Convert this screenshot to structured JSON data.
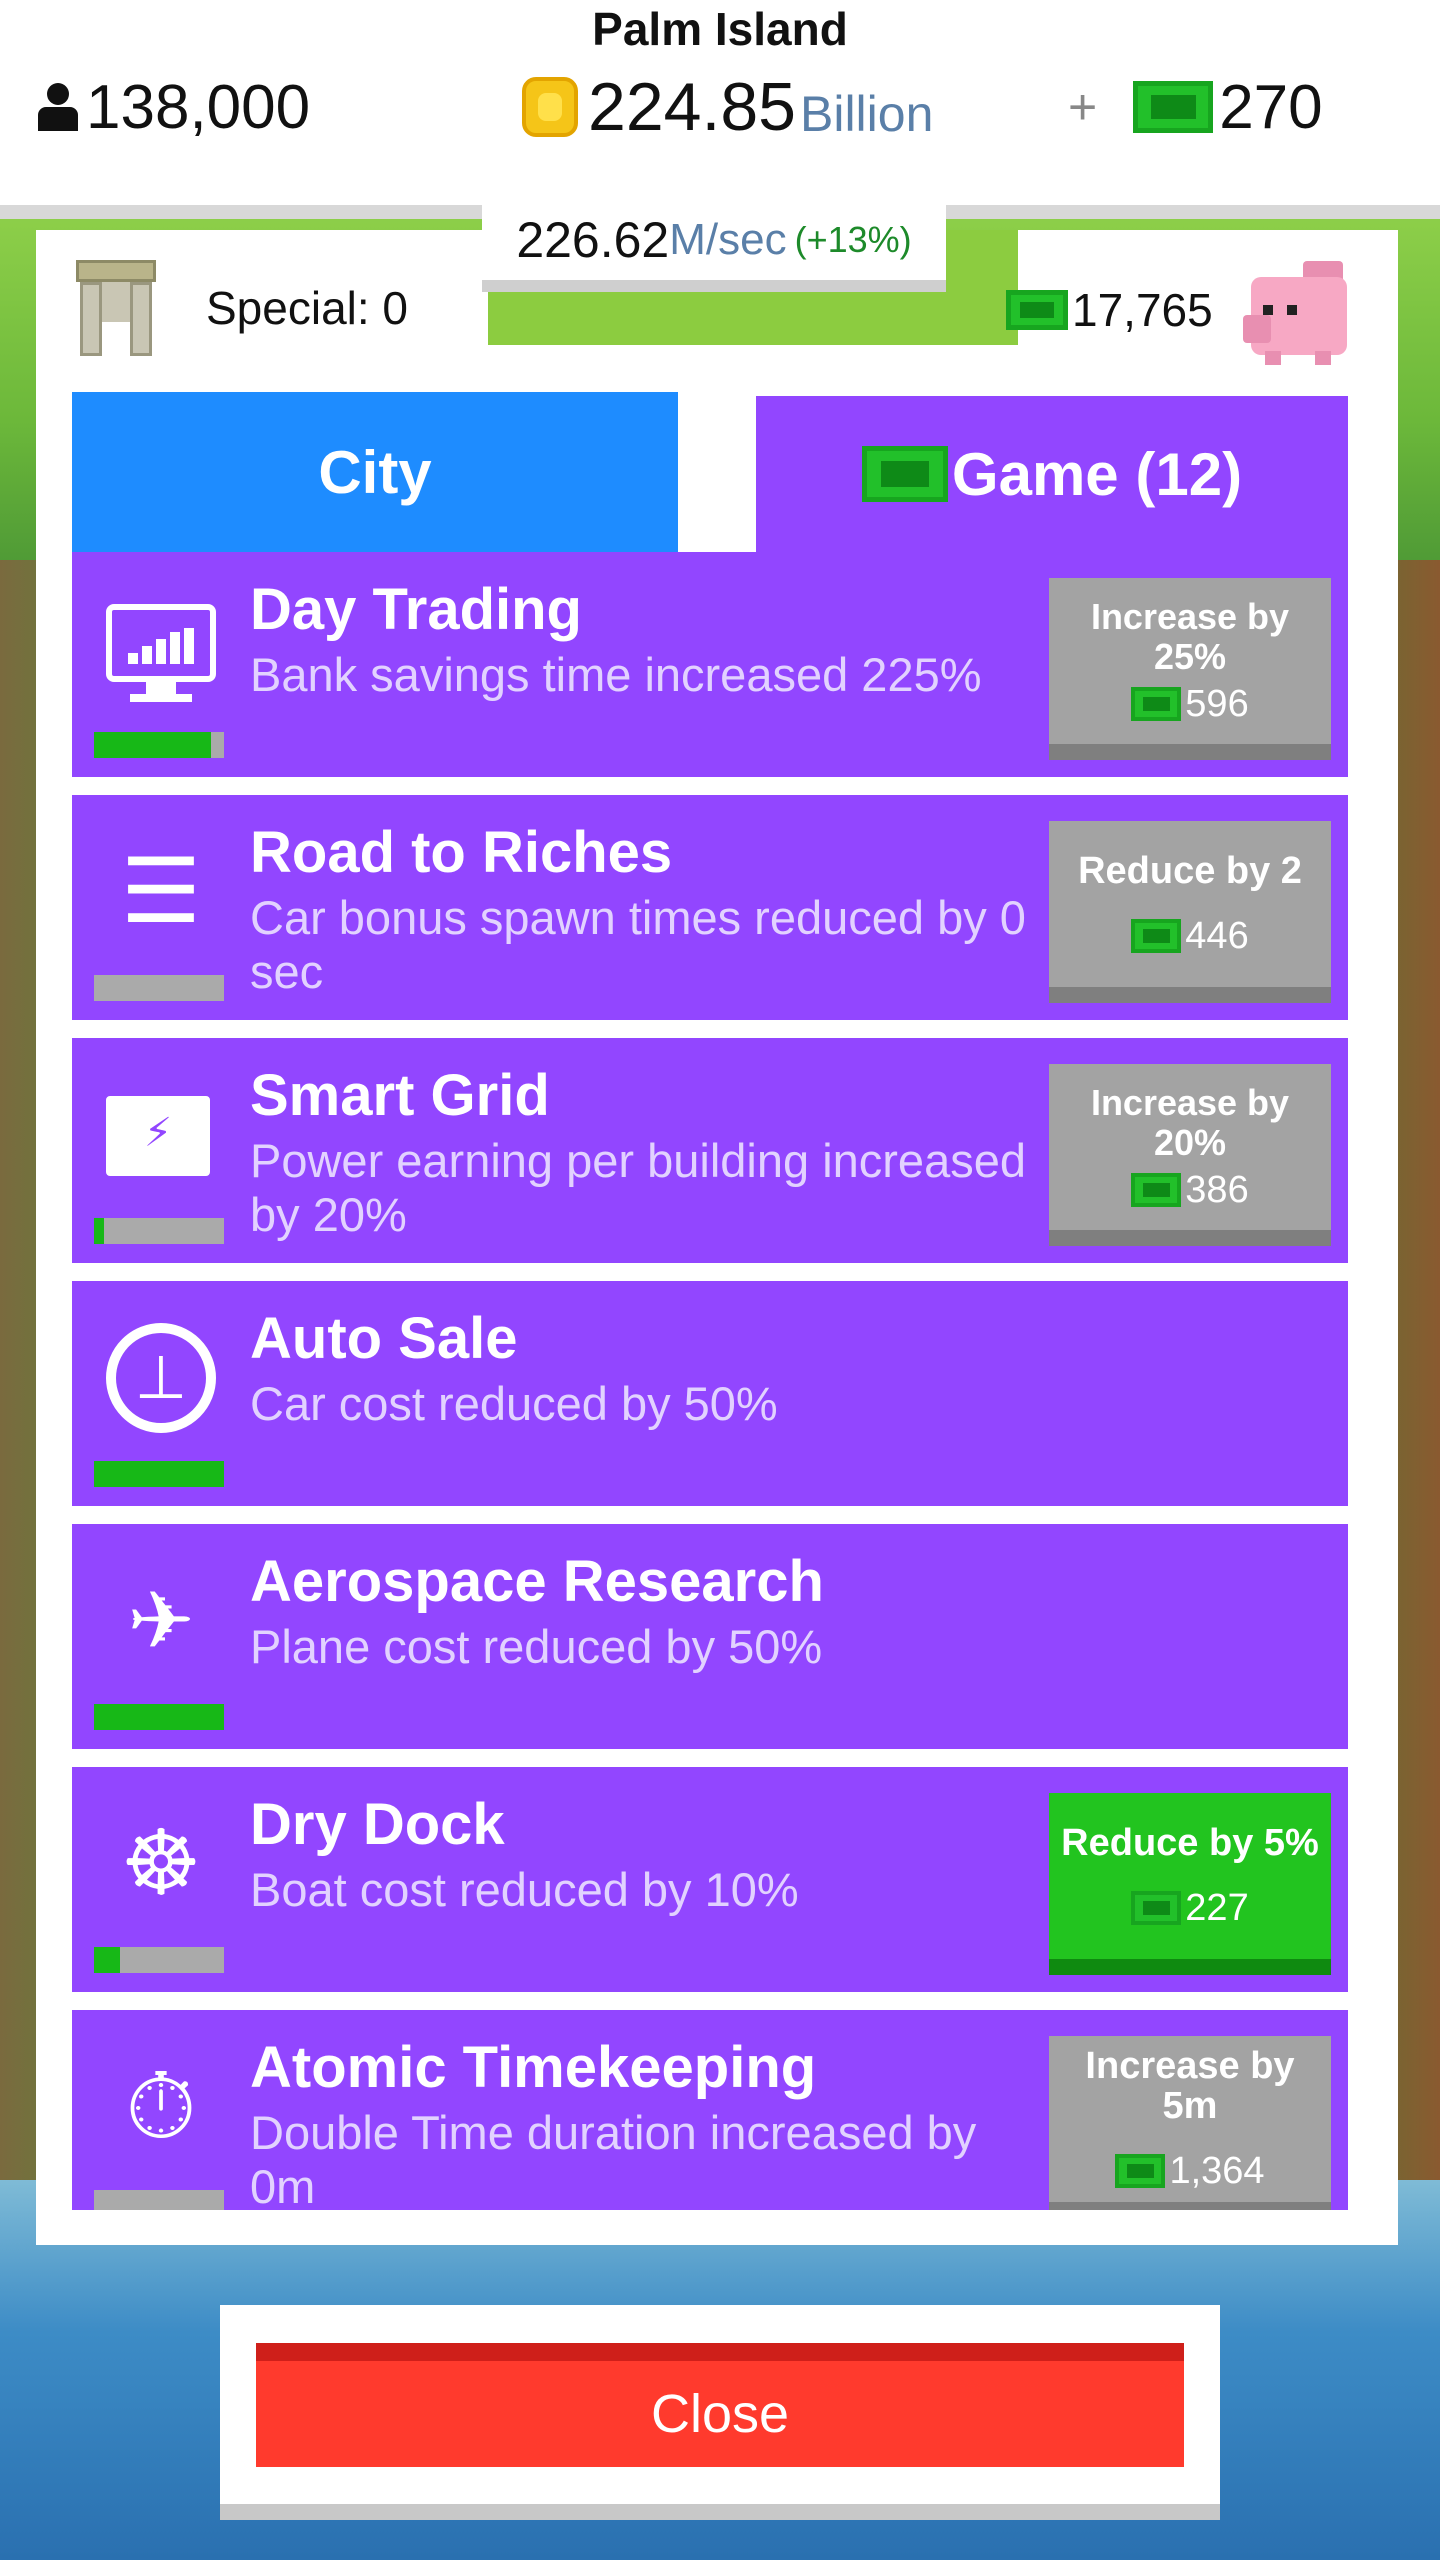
{
  "header": {
    "island_name": "Palm Island",
    "population": "138,000",
    "coins_amount": "224.85",
    "coins_unit": "Billion",
    "plus_label": "+",
    "cash_amount": "270"
  },
  "rate": {
    "value": "226.62",
    "unit": "M/sec",
    "bonus": "(+13%)"
  },
  "panel": {
    "special_label": "Special: 0",
    "bank_amount": "17,765"
  },
  "tabs": [
    {
      "label": "City",
      "active": true
    },
    {
      "label": "Game (12)",
      "active": false
    }
  ],
  "upgrades": [
    {
      "name": "Day Trading",
      "description": "Bank savings time increased 225%",
      "icon": "monitor-chart-icon",
      "progress": 0.9,
      "button": {
        "label": "Increase by 25%",
        "price": "596",
        "state": "disabled"
      }
    },
    {
      "name": "Road to Riches",
      "description": "Car bonus spawn times reduced by 0 sec",
      "icon": "coin-stack-icon",
      "progress": 0.0,
      "button": {
        "label": "Reduce by 2",
        "price": "446",
        "state": "disabled"
      }
    },
    {
      "name": "Smart Grid",
      "description": "Power earning per building increased by 20%",
      "icon": "battery-icon",
      "progress": 0.08,
      "button": {
        "label": "Increase by 20%",
        "price": "386",
        "state": "disabled"
      }
    },
    {
      "name": "Auto Sale",
      "description": "Car cost reduced by 50%",
      "icon": "steering-wheel-icon",
      "progress": 1.0,
      "button": null
    },
    {
      "name": "Aerospace Research",
      "description": "Plane cost reduced by 50%",
      "icon": "plane-dial-icon",
      "progress": 1.0,
      "button": null
    },
    {
      "name": "Dry Dock",
      "description": "Boat cost reduced by 10%",
      "icon": "ship-wheel-icon",
      "progress": 0.2,
      "button": {
        "label": "Reduce by 5%",
        "price": "227",
        "state": "available"
      }
    },
    {
      "name": "Atomic Timekeeping",
      "description": "Double Time duration increased by 0m",
      "icon": "stopwatch-icon",
      "progress": 0.0,
      "button": {
        "label": "Increase by 5m",
        "price": "1,364",
        "state": "disabled"
      }
    }
  ],
  "close_label": "Close",
  "colors": {
    "row_purple": "#9246ff",
    "tab_blue": "#1e8cff",
    "available_green": "#22c41f",
    "disabled_gray": "#a3a3a3",
    "close_red": "#ff3a2d"
  }
}
